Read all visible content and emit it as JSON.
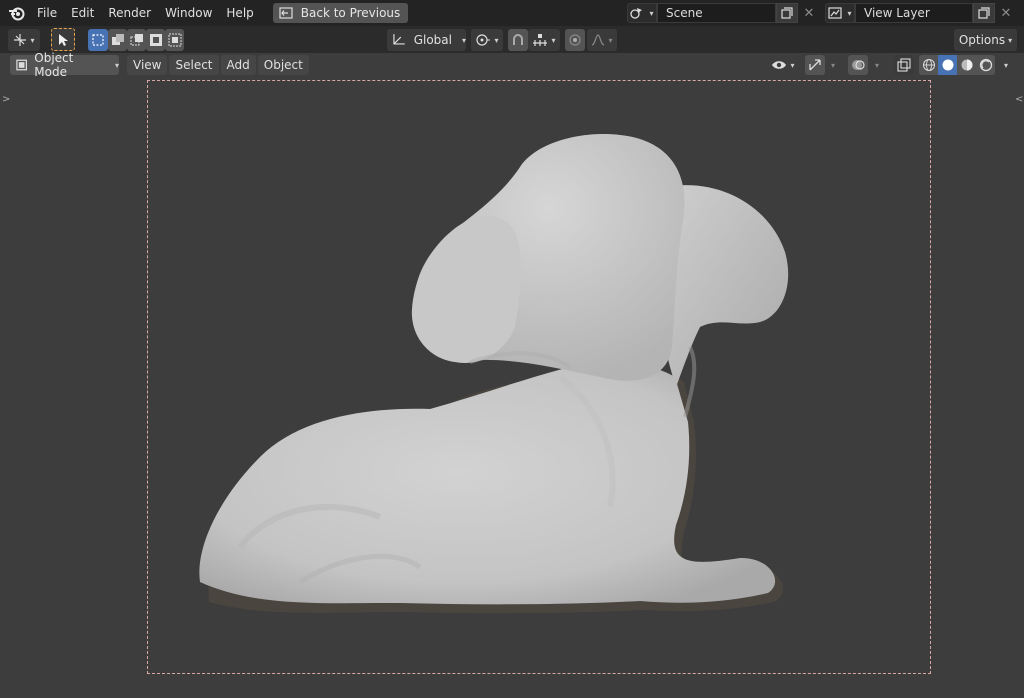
{
  "menu": {
    "file": "File",
    "edit": "Edit",
    "render": "Render",
    "window": "Window",
    "help": "Help",
    "back_to_previous": "Back to Previous"
  },
  "scene": {
    "name": "Scene"
  },
  "view_layer": {
    "name": "View Layer"
  },
  "toolbar": {
    "transform_orientation": "Global",
    "options_label": "Options"
  },
  "header": {
    "mode": "Object Mode",
    "view": "View",
    "select": "Select",
    "add": "Add",
    "object": "Object"
  },
  "viewport": {
    "shading_active": "solid"
  },
  "colors": {
    "topbar_bg": "#232323",
    "toolrow_bg": "#2b2b2b",
    "viewport_bg": "#3d3d3d",
    "accent_blue": "#4772b3",
    "select_orange": "#e8a44a",
    "mesh_color": "#c9c9c9"
  }
}
